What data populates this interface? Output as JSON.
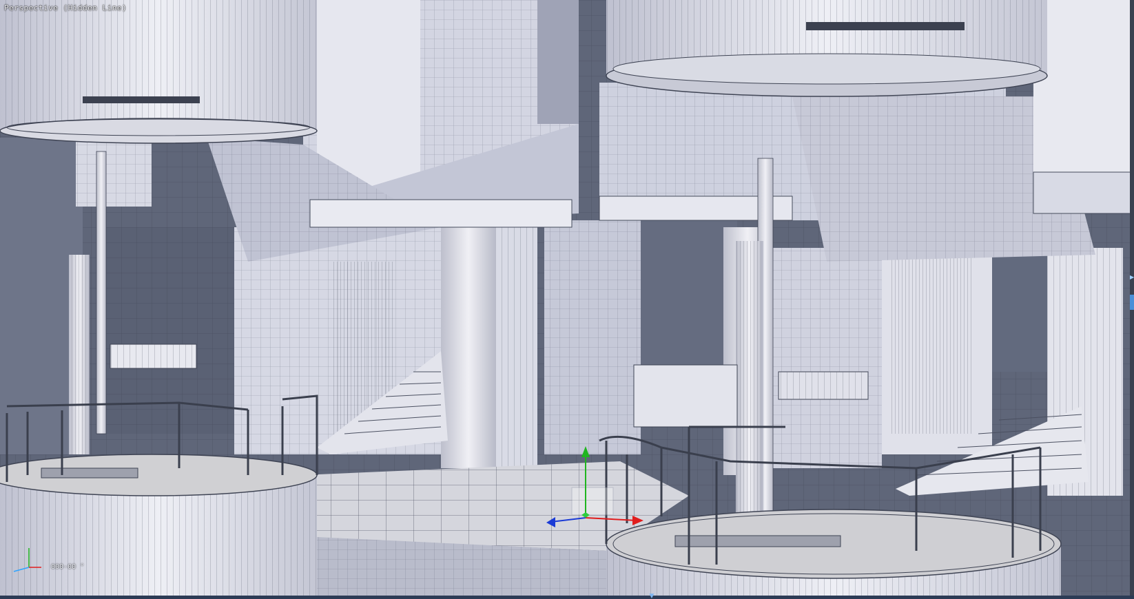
{
  "viewport": {
    "label": "Perspective (Hidden Line)",
    "coordinate_readout": "000-00 °"
  },
  "gizmo": {
    "x_color": "#e11d1d",
    "y_color": "#1fb51f",
    "z_color": "#1b3bd6"
  },
  "colors": {
    "wall_light": "#e8e9f1",
    "wall_mid": "#c7c9d8",
    "wall_dark": "#5c6478",
    "floor": "#d3d3d8",
    "accent": "#4a8fd8"
  }
}
